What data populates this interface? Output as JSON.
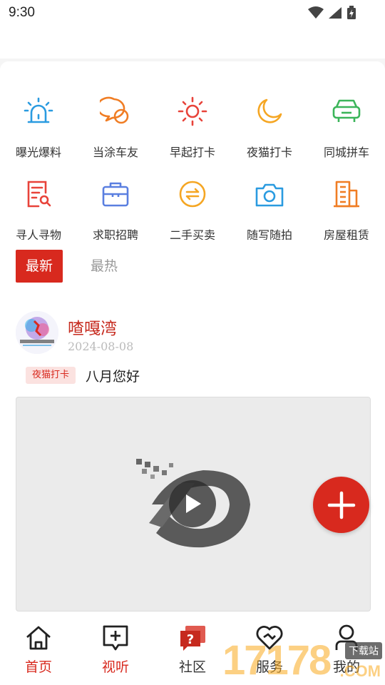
{
  "status": {
    "time": "9:30"
  },
  "services": [
    {
      "label": "曝光爆料",
      "icon": "siren-icon"
    },
    {
      "label": "当涂车友",
      "icon": "chat-bubbles-icon"
    },
    {
      "label": "早起打卡",
      "icon": "sun-icon"
    },
    {
      "label": "夜猫打卡",
      "icon": "moon-icon"
    },
    {
      "label": "同城拼车",
      "icon": "car-icon"
    },
    {
      "label": "寻人寻物",
      "icon": "search-document-icon"
    },
    {
      "label": "求职招聘",
      "icon": "briefcase-icon"
    },
    {
      "label": "二手买卖",
      "icon": "exchange-icon"
    },
    {
      "label": "随写随拍",
      "icon": "camera-icon"
    },
    {
      "label": "房屋租赁",
      "icon": "building-icon"
    }
  ],
  "tabs": {
    "latest": "最新",
    "hot": "最热"
  },
  "post": {
    "author": "喳嘎湾",
    "date": "2024-08-08",
    "tag": "夜猫打卡",
    "text": "八月您好"
  },
  "nav": [
    {
      "label": "首页",
      "icon": "home-icon"
    },
    {
      "label": "视听",
      "icon": "video-add-icon"
    },
    {
      "label": "社区",
      "icon": "community-icon"
    },
    {
      "label": "服务",
      "icon": "service-heart-icon"
    },
    {
      "label": "我的",
      "icon": "profile-icon"
    }
  ],
  "watermark": {
    "number": "17178",
    "download": "下载站",
    "com": ".COM"
  },
  "colors": {
    "accent": "#d8291e",
    "blue": "#2a9be0",
    "orange": "#f5a623",
    "green": "#3cb55a"
  }
}
